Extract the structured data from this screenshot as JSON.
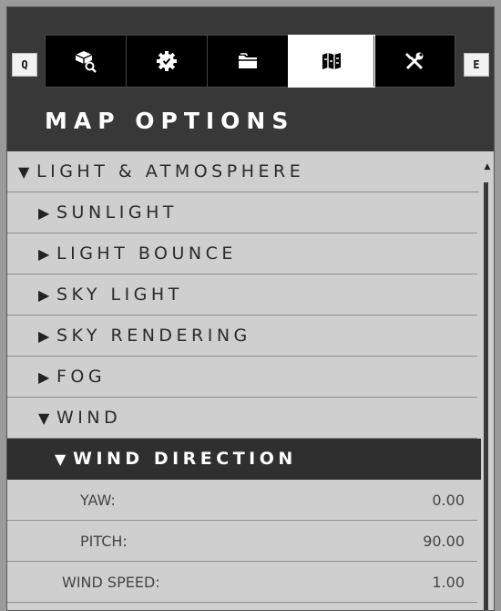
{
  "header": {
    "title": "MAP OPTIONS",
    "key_left": "Q",
    "key_right": "E"
  },
  "tabs": [
    {
      "icon": "cube-search-icon",
      "active": false
    },
    {
      "icon": "gear-icon",
      "active": false
    },
    {
      "icon": "folder-icon",
      "active": false
    },
    {
      "icon": "map-icon",
      "active": true
    },
    {
      "icon": "tools-icon",
      "active": false
    }
  ],
  "sections": {
    "light_atmosphere": "LIGHT & ATMOSPHERE",
    "sunlight": "SUNLIGHT",
    "light_bounce": "LIGHT BOUNCE",
    "sky_light": "SKY LIGHT",
    "sky_rendering": "SKY RENDERING",
    "fog": "FOG",
    "wind": "WIND",
    "wind_direction": "WIND DIRECTION"
  },
  "properties": {
    "yaw": {
      "label": "YAW:",
      "value": "0.00"
    },
    "pitch": {
      "label": "PITCH:",
      "value": "90.00"
    },
    "wind_speed": {
      "label": "WIND SPEED:",
      "value": "1.00"
    }
  },
  "colors": {
    "panel_dark": "#383838",
    "list_bg": "#cfcfcf",
    "selected_bg": "#2f2f2f",
    "accent_text": "#ffffff"
  }
}
